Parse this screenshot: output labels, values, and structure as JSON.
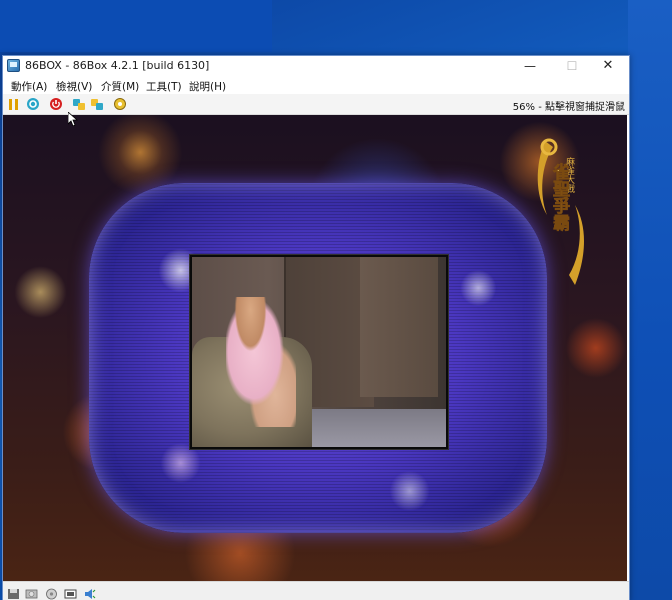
{
  "window": {
    "title": "86BOX - 86Box 4.2.1 [build 6130]",
    "min_glyph": "—",
    "max_glyph": "☐",
    "close_glyph": "✕"
  },
  "menu": [
    {
      "label": "動作(A)"
    },
    {
      "label": "檢視(V)"
    },
    {
      "label": "介質(M)"
    },
    {
      "label": "工具(T)"
    },
    {
      "label": "說明(H)"
    }
  ],
  "toolbar": {
    "icons": [
      "pause-icon",
      "reset-icon",
      "power-icon",
      "ctrl-alt-del-icon",
      "ctrl-alt-esc-icon",
      "settings-icon"
    ],
    "status_text": "56% - 點擊視窗捕捉滑鼠"
  },
  "screen": {
    "logo_text": "雀聖爭霸",
    "logo_subtext": "麻雀大戰"
  },
  "statusbar": {
    "icons": [
      "floppy-drive-icon",
      "cdrom-drive-icon",
      "hard-disk-icon",
      "network-icon",
      "sound-icon"
    ]
  },
  "colors": {
    "accent_purple": "#4a37c0",
    "desktop_blue": "#1565c8",
    "logo_gold": "#e0b040"
  }
}
